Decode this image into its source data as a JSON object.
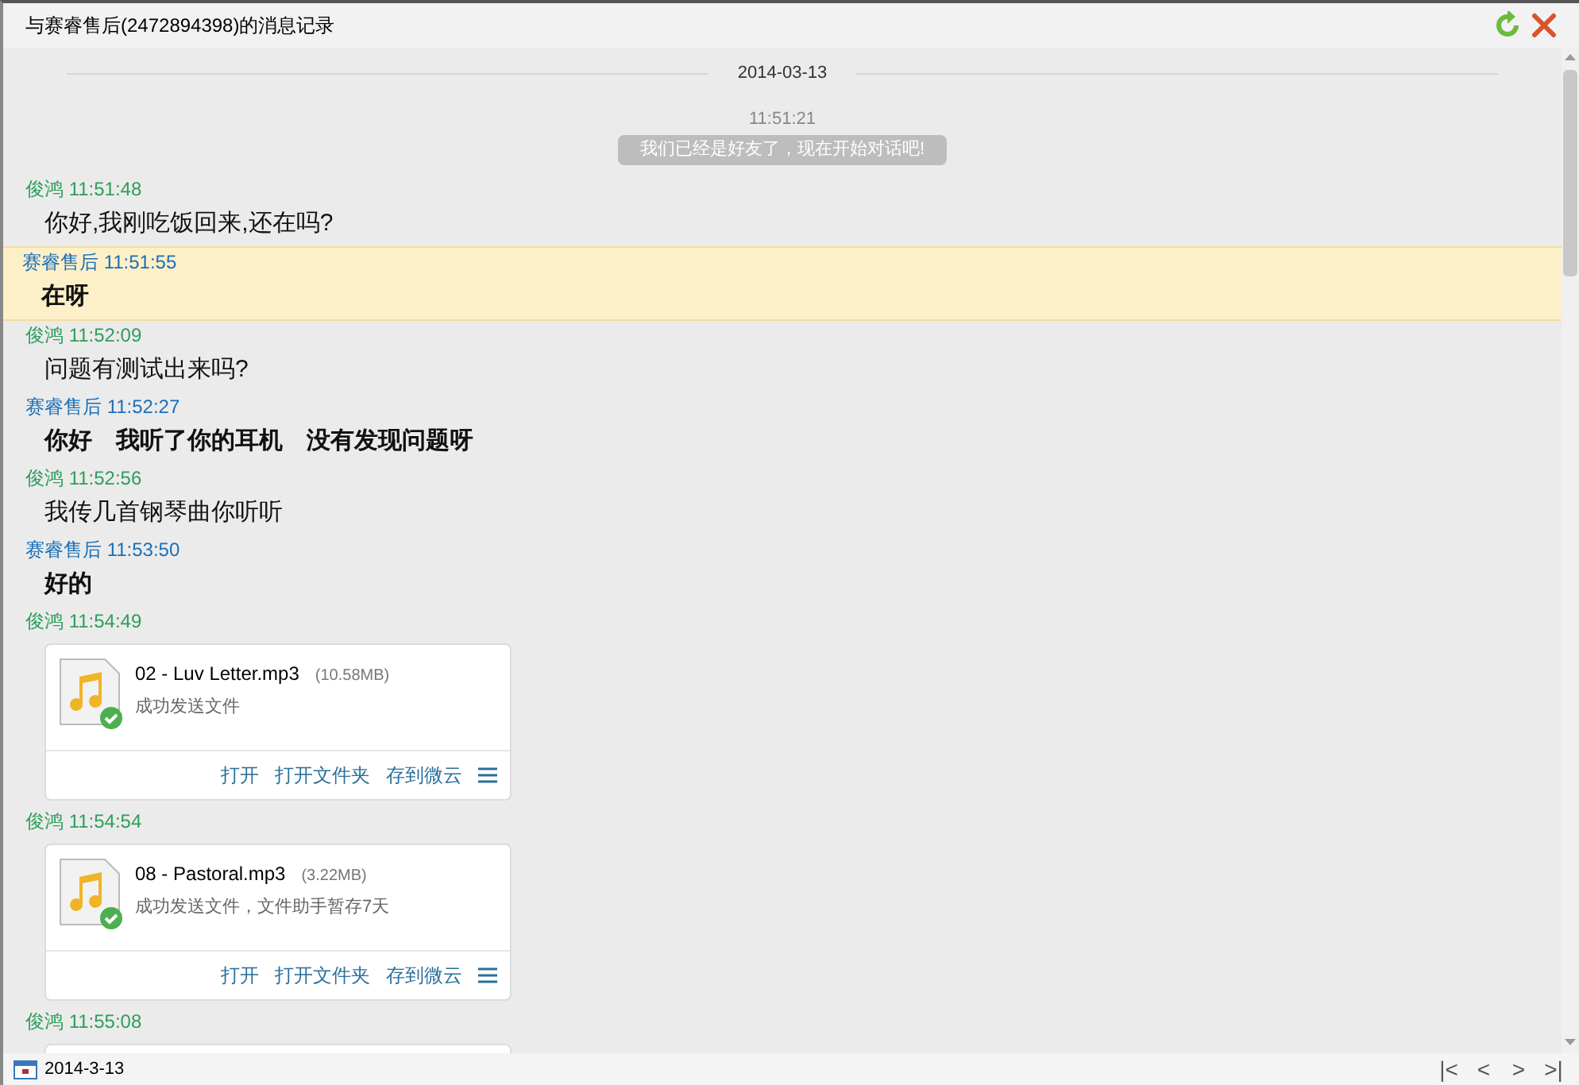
{
  "window": {
    "title": "与赛睿售后(2472894398)的消息记录"
  },
  "date_divider": "2014-03-13",
  "system_notice": {
    "time": "11:51:21",
    "text": "我们已经是好友了，现在开始对话吧!"
  },
  "messages": [
    {
      "kind": "text",
      "color": "#2e9e5a",
      "sender": "俊鸿",
      "time": "11:51:48",
      "text": "你好,我刚吃饭回来,还在吗?",
      "selected": false
    },
    {
      "kind": "bold_text",
      "color": "#1a6fb8",
      "sender": "赛睿售后",
      "time": "11:51:55",
      "text": "在呀",
      "selected": true
    },
    {
      "kind": "text",
      "color": "#2e9e5a",
      "sender": "俊鸿",
      "time": "11:52:09",
      "text": "问题有测试出来吗?",
      "selected": false
    },
    {
      "kind": "bold_text",
      "color": "#1a6fb8",
      "sender": "赛睿售后",
      "time": "11:52:27",
      "text": "你好　我听了你的耳机　没有发现问题呀",
      "selected": false
    },
    {
      "kind": "text",
      "color": "#2e9e5a",
      "sender": "俊鸿",
      "time": "11:52:56",
      "text": "我传几首钢琴曲你听听",
      "selected": false
    },
    {
      "kind": "bold_text",
      "color": "#1a6fb8",
      "sender": "赛睿售后",
      "time": "11:53:50",
      "text": "好的",
      "selected": false
    },
    {
      "kind": "file",
      "color": "#2e9e5a",
      "sender": "俊鸿",
      "time": "11:54:49",
      "file_name": "02 - Luv Letter.mp3",
      "size": "(10.58MB)",
      "status": "成功发送文件",
      "actions": [
        "打开",
        "打开文件夹",
        "存到微云"
      ],
      "selected": false
    },
    {
      "kind": "file",
      "color": "#2e9e5a",
      "sender": "俊鸿",
      "time": "11:54:54",
      "file_name": "08 - Pastoral.mp3",
      "size": "(3.22MB)",
      "status": "成功发送文件，文件助手暂存7天",
      "actions": [
        "打开",
        "打开文件夹",
        "存到微云"
      ],
      "selected": false
    },
    {
      "kind": "file_partial",
      "color": "#2e9e5a",
      "sender": "俊鸿",
      "time": "11:55:08",
      "selected": false
    }
  ],
  "bottom_bar": {
    "date": "2014-3-13",
    "pager": [
      "|<",
      "<",
      ">",
      ">|"
    ]
  }
}
